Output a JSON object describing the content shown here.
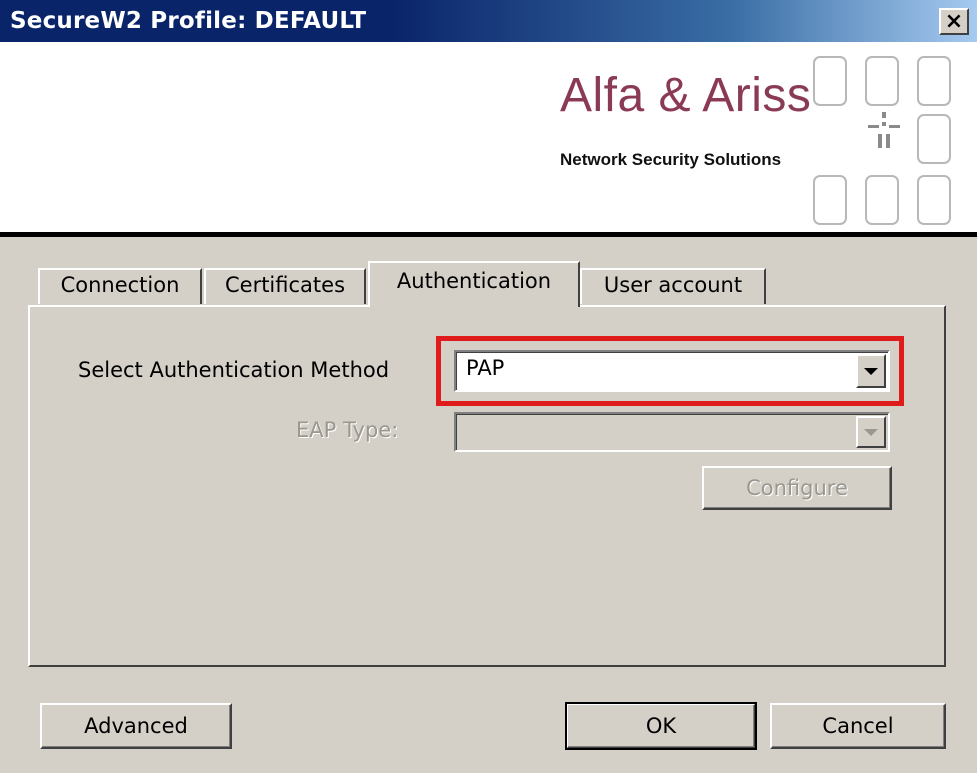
{
  "window": {
    "title": "SecureW2 Profile: DEFAULT",
    "close_label": "×"
  },
  "banner": {
    "logo_name": "Alfa & Ariss",
    "logo_tagline": "Network Security Solutions",
    "logo_icon": "alfa-ariss-logo"
  },
  "tabs": [
    {
      "label": "Connection",
      "active": false
    },
    {
      "label": "Certificates",
      "active": false
    },
    {
      "label": "Authentication",
      "active": true
    },
    {
      "label": "User account",
      "active": false
    }
  ],
  "authentication": {
    "method_label": "Select Authentication Method",
    "method_value": "PAP",
    "eap_label": "EAP Type:",
    "eap_value": "",
    "configure_label": "Configure"
  },
  "buttons": {
    "advanced": "Advanced",
    "ok": "OK",
    "cancel": "Cancel"
  },
  "colors": {
    "title_bar": "#0a246a",
    "logo_text": "#8b3a55",
    "highlight": "#e01b1b",
    "face": "#d4d0c8"
  }
}
